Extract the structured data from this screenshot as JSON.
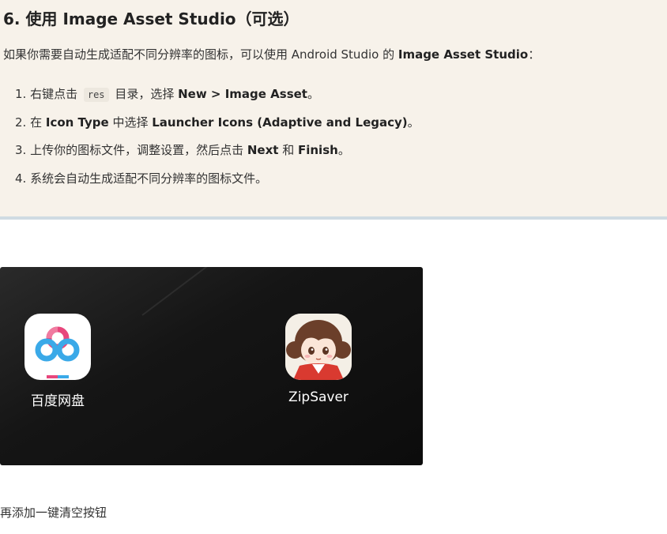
{
  "section": {
    "heading": "6. 使用 Image Asset Studio（可选）",
    "intro_prefix": "如果你需要自动生成适配不同分辨率的图标，可以使用 Android Studio 的 ",
    "intro_bold": "Image Asset Studio",
    "intro_suffix": "："
  },
  "steps": [
    {
      "a": "1. 右键点击 ",
      "code": "res",
      "b": " 目录，选择 ",
      "bold": "New > Image Asset",
      "c": "。"
    },
    {
      "a": "2. 在 ",
      "bold1": "Icon Type",
      "b": " 中选择 ",
      "bold2": "Launcher Icons (Adaptive and Legacy)",
      "c": "。"
    },
    {
      "a": "3. 上传你的图标文件，调整设置，然后点击 ",
      "bold1": "Next",
      "b": " 和 ",
      "bold2": "Finish",
      "c": "。"
    },
    {
      "a": "4. 系统会自动生成适配不同分辨率的图标文件。"
    }
  ],
  "launcher": {
    "apps": [
      {
        "label": "百度网盘",
        "icon": "baidu-netdisk-icon"
      },
      {
        "label": "ZipSaver",
        "icon": "zipsaver-anime-girl-icon"
      }
    ]
  },
  "footer": {
    "text": "再添加一键清空按钮"
  }
}
